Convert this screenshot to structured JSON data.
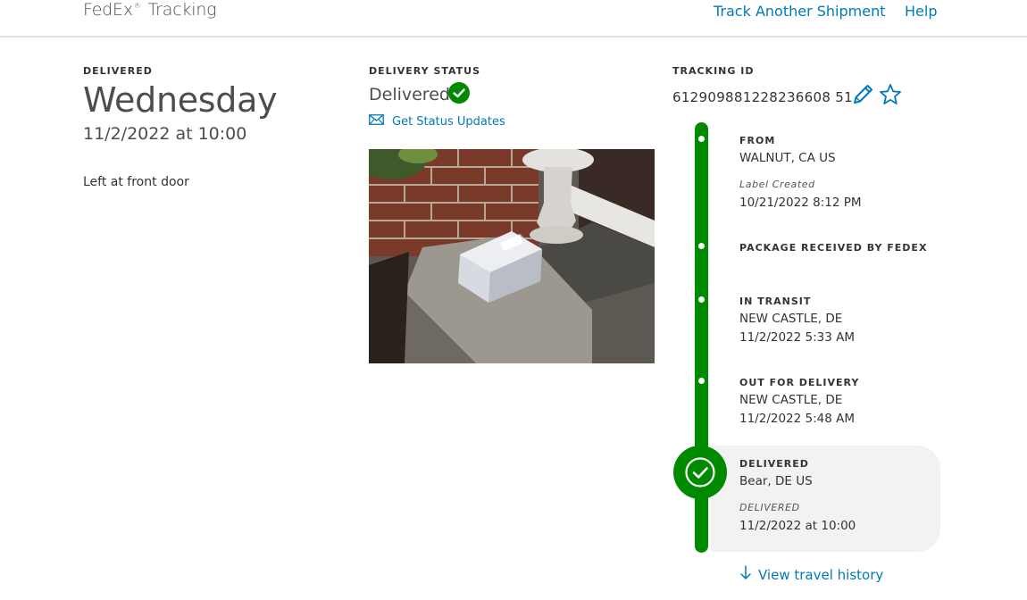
{
  "header": {
    "brand": "FedEx",
    "brand_sup": "®",
    "brand_suffix": "Tracking",
    "nav": {
      "track_another": "Track Another Shipment",
      "help": "Help"
    }
  },
  "summary": {
    "status_label": "DELIVERED",
    "day": "Wednesday",
    "datetime": "11/2/2022 at 10:00",
    "note": "Left at front door"
  },
  "delivery_status": {
    "label": "DELIVERY STATUS",
    "value": "Delivered",
    "updates_link": "Get Status Updates"
  },
  "tracking": {
    "label": "TRACKING ID",
    "id": "612909881228236608 51"
  },
  "timeline": [
    {
      "title": "FROM",
      "line1": "WALNUT, CA US",
      "italic": "Label Created",
      "line2": "10/21/2022 8:12 PM"
    },
    {
      "title": "PACKAGE RECEIVED BY FEDEX"
    },
    {
      "title": "IN TRANSIT",
      "line1": "NEW CASTLE, DE",
      "line2": "11/2/2022 5:33 AM"
    },
    {
      "title": "OUT FOR DELIVERY",
      "line1": "NEW CASTLE, DE",
      "line2": "11/2/2022 5:48 AM"
    },
    {
      "title": "DELIVERED",
      "line1": "Bear, DE US",
      "italic": "DELIVERED",
      "line2": "11/2/2022 at 10:00"
    }
  ],
  "history_link": "View travel history",
  "colors": {
    "accent": "#007ab7",
    "success": "#008a00",
    "card": "#f2f2f2"
  }
}
